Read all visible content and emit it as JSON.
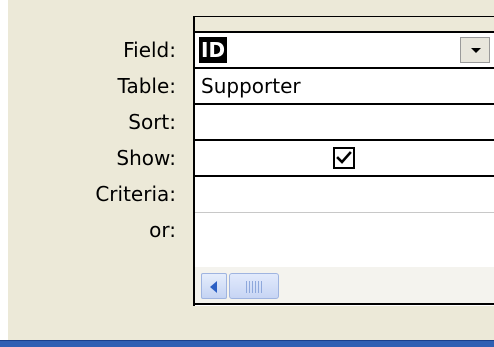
{
  "labels": {
    "field": "Field:",
    "table": "Table:",
    "sort": "Sort:",
    "show": "Show:",
    "criteria": "Criteria:",
    "or": "or:"
  },
  "grid": {
    "field_value": "ID",
    "table_value": "Supporter",
    "sort_value": "",
    "show_checked": true,
    "criteria_value": "",
    "or_value": ""
  },
  "icons": {
    "dropdown": "chevron-down-icon",
    "checkmark": "checkmark-icon",
    "scroll_left": "arrow-left-icon",
    "scroll_thumb": "scroll-thumb-grip-icon"
  },
  "colors": {
    "background": "#ece9d8",
    "selection": "#000000",
    "scroll_accent": "#2b5fc4",
    "bottom_bar": "#2f5fb3"
  }
}
